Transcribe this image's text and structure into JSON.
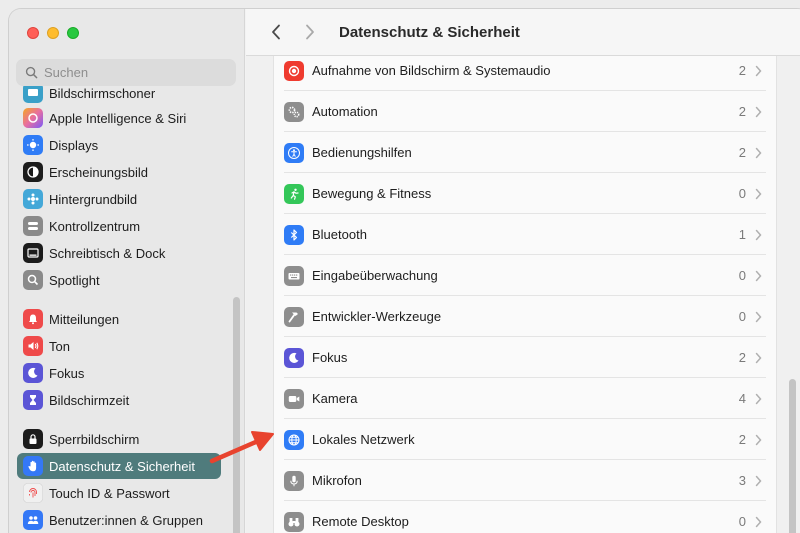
{
  "window": {
    "title": "Datenschutz & Sicherheit"
  },
  "search": {
    "placeholder": "Suchen"
  },
  "sidebar": {
    "items": [
      {
        "label": "Bildschirmschoner",
        "icon": "screensaver-icon",
        "color": "#3aa0c8"
      },
      {
        "label": "Apple Intelligence & Siri",
        "icon": "siri-icon",
        "color": "#e86ea0"
      },
      {
        "label": "Displays",
        "icon": "display-icon",
        "color": "#2f7cf6"
      },
      {
        "label": "Erscheinungsbild",
        "icon": "appearance-icon",
        "color": "#1c1c1c"
      },
      {
        "label": "Hintergrundbild",
        "icon": "wallpaper-icon",
        "color": "#44a8d8"
      },
      {
        "label": "Kontrollzentrum",
        "icon": "control-center-icon",
        "color": "#8a8a8a"
      },
      {
        "label": "Schreibtisch & Dock",
        "icon": "dock-icon",
        "color": "#1c1c1c"
      },
      {
        "label": "Spotlight",
        "icon": "spotlight-icon",
        "color": "#8a8a8a"
      },
      {
        "label": "Mitteilungen",
        "icon": "notifications-icon",
        "color": "#ef4a4a"
      },
      {
        "label": "Ton",
        "icon": "sound-icon",
        "color": "#ef4a4a"
      },
      {
        "label": "Fokus",
        "icon": "focus-icon",
        "color": "#5b55d6"
      },
      {
        "label": "Bildschirmzeit",
        "icon": "screen-time-icon",
        "color": "#5b55d6"
      },
      {
        "label": "Sperrbildschirm",
        "icon": "lock-icon",
        "color": "#1c1c1c"
      },
      {
        "label": "Datenschutz & Sicherheit",
        "icon": "hand-icon",
        "color": "#3478f6"
      },
      {
        "label": "Touch ID & Passwort",
        "icon": "fingerprint-icon",
        "color": "#f0f0f0"
      },
      {
        "label": "Benutzer:innen & Gruppen",
        "icon": "users-icon",
        "color": "#3478f6"
      }
    ]
  },
  "main": {
    "rows": [
      {
        "label": "Aufnahme von Bildschirm & Systemaudio",
        "count": "2",
        "icon": "screen-record-icon",
        "color": "#ef3b2f"
      },
      {
        "label": "Automation",
        "count": "2",
        "icon": "gears-icon",
        "color": "#8e8e8e"
      },
      {
        "label": "Bedienungshilfen",
        "count": "2",
        "icon": "accessibility-icon",
        "color": "#2f7cf6"
      },
      {
        "label": "Bewegung & Fitness",
        "count": "0",
        "icon": "fitness-icon",
        "color": "#34c759"
      },
      {
        "label": "Bluetooth",
        "count": "1",
        "icon": "bluetooth-icon",
        "color": "#2f7cf6"
      },
      {
        "label": "Eingabeüberwachung",
        "count": "0",
        "icon": "keyboard-icon",
        "color": "#8e8e8e"
      },
      {
        "label": "Entwickler-Werkzeuge",
        "count": "0",
        "icon": "hammer-icon",
        "color": "#8e8e8e"
      },
      {
        "label": "Fokus",
        "count": "2",
        "icon": "moon-icon",
        "color": "#5b55d6"
      },
      {
        "label": "Kamera",
        "count": "4",
        "icon": "camera-icon",
        "color": "#8e8e8e"
      },
      {
        "label": "Lokales Netzwerk",
        "count": "2",
        "icon": "globe-icon",
        "color": "#2f7cf6"
      },
      {
        "label": "Mikrofon",
        "count": "3",
        "icon": "microphone-icon",
        "color": "#8e8e8e"
      },
      {
        "label": "Remote Desktop",
        "count": "0",
        "icon": "binoculars-icon",
        "color": "#8e8e8e"
      }
    ]
  },
  "annotation": {
    "arrow_color": "#e8432e"
  }
}
